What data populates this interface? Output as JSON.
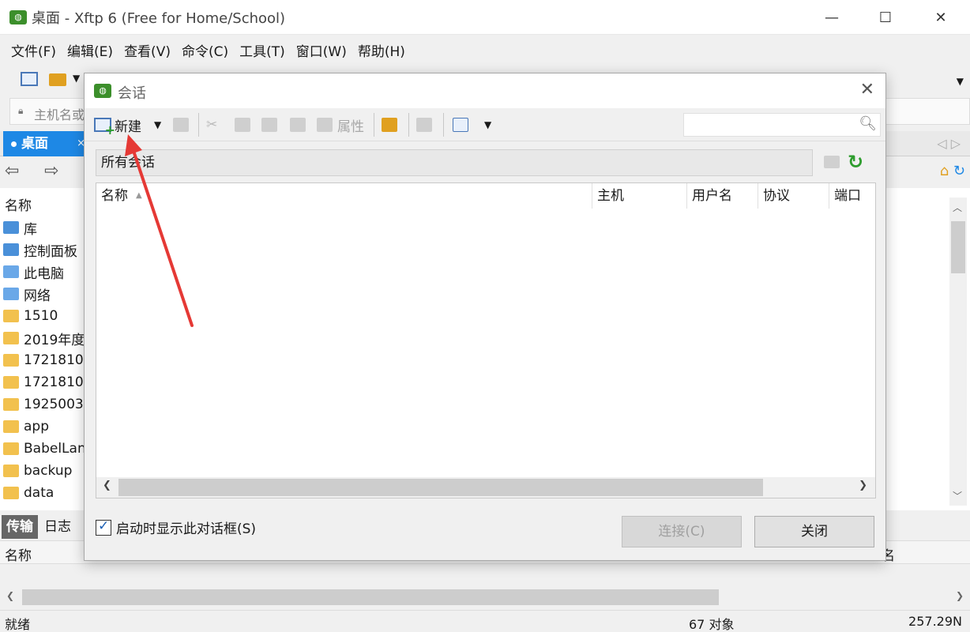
{
  "window": {
    "title": "桌面 - Xftp 6 (Free for Home/School)",
    "controls": {
      "minimize": "—",
      "maximize": "☐",
      "close": "✕"
    }
  },
  "menu": [
    "文件(F)",
    "编辑(E)",
    "查看(V)",
    "命令(C)",
    "工具(T)",
    "窗口(W)",
    "帮助(H)"
  ],
  "address": {
    "placeholder": "主机名或"
  },
  "tab": {
    "label": "桌面",
    "close": "×"
  },
  "file_pane": {
    "column": "名称",
    "files": [
      {
        "name": "库",
        "icon": "library-icon"
      },
      {
        "name": "控制面板",
        "icon": "control-panel-icon"
      },
      {
        "name": "此电脑",
        "icon": "computer-icon"
      },
      {
        "name": "网络",
        "icon": "network-icon"
      },
      {
        "name": "1510",
        "icon": "folder-icon"
      },
      {
        "name": "2019年度",
        "icon": "folder-icon"
      },
      {
        "name": "1721810",
        "icon": "folder-icon"
      },
      {
        "name": "1721810",
        "icon": "folder-icon"
      },
      {
        "name": "1925003",
        "icon": "folder-icon"
      },
      {
        "name": "app",
        "icon": "folder-icon"
      },
      {
        "name": "BabelLan",
        "icon": "folder-icon"
      },
      {
        "name": "backup",
        "icon": "folder-icon"
      },
      {
        "name": "data",
        "icon": "folder-icon"
      }
    ]
  },
  "bottom_tabs": {
    "transfer": "传输",
    "log": "日志"
  },
  "transfer_header": {
    "name": "名称",
    "right_fragment": "名"
  },
  "status": {
    "left": "就绪",
    "count": "67 对象",
    "size": "257.29N"
  },
  "dialog": {
    "title": "会话",
    "toolbar": {
      "new": "新建",
      "properties": "属性"
    },
    "all_sessions": "所有会话",
    "columns": [
      "名称",
      "主机",
      "用户名",
      "协议",
      "端口"
    ],
    "startup_checkbox": "启动时显示此对话框(S)",
    "startup_checked": true,
    "connect_button": "连接(C)",
    "close_button": "关闭"
  },
  "colors": {
    "accent": "#1e88e5",
    "annotation_arrow": "#e53935",
    "brand_green": "#3c8f2b"
  }
}
